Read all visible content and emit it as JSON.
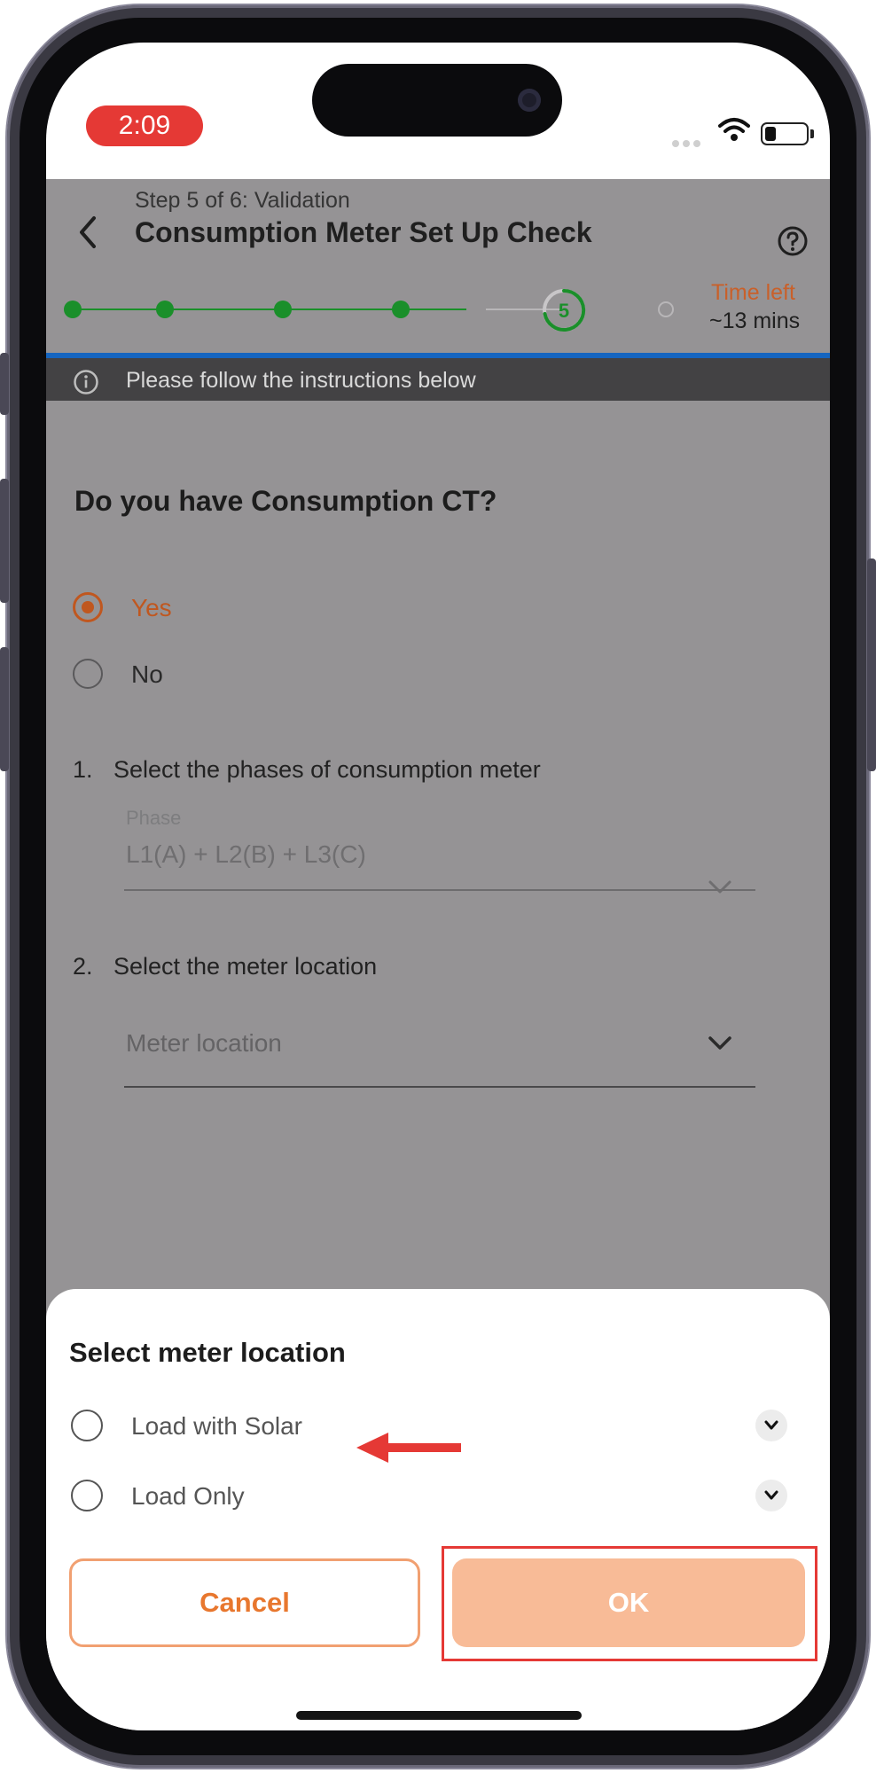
{
  "status": {
    "time": "2:09"
  },
  "header": {
    "step_label": "Step 5 of 6: Validation",
    "title": "Consumption Meter Set Up Check",
    "current_step": "5",
    "time_left_label": "Time left",
    "time_left_value": "~13 mins"
  },
  "info": {
    "text": "Please follow the instructions below"
  },
  "question": {
    "text": "Do you have Consumption CT?",
    "options": [
      {
        "label": "Yes",
        "selected": true
      },
      {
        "label": "No",
        "selected": false
      }
    ]
  },
  "steps": [
    {
      "num": "1.",
      "text": "Select the phases of consumption meter"
    },
    {
      "num": "2.",
      "text": "Select the meter location"
    }
  ],
  "phase_field": {
    "label": "Phase",
    "value": "L1(A) + L2(B) + L3(C)"
  },
  "location_field": {
    "placeholder": "Meter location"
  },
  "sheet": {
    "title": "Select meter location",
    "options": [
      {
        "label": "Load with Solar"
      },
      {
        "label": "Load Only"
      }
    ],
    "cancel_label": "Cancel",
    "ok_label": "OK"
  },
  "colors": {
    "accent": "#e8772e",
    "ok_bg": "#f8bb97",
    "progress_green": "#1a8f2a",
    "progress_blue": "#1565c0",
    "highlight": "#e53935"
  }
}
